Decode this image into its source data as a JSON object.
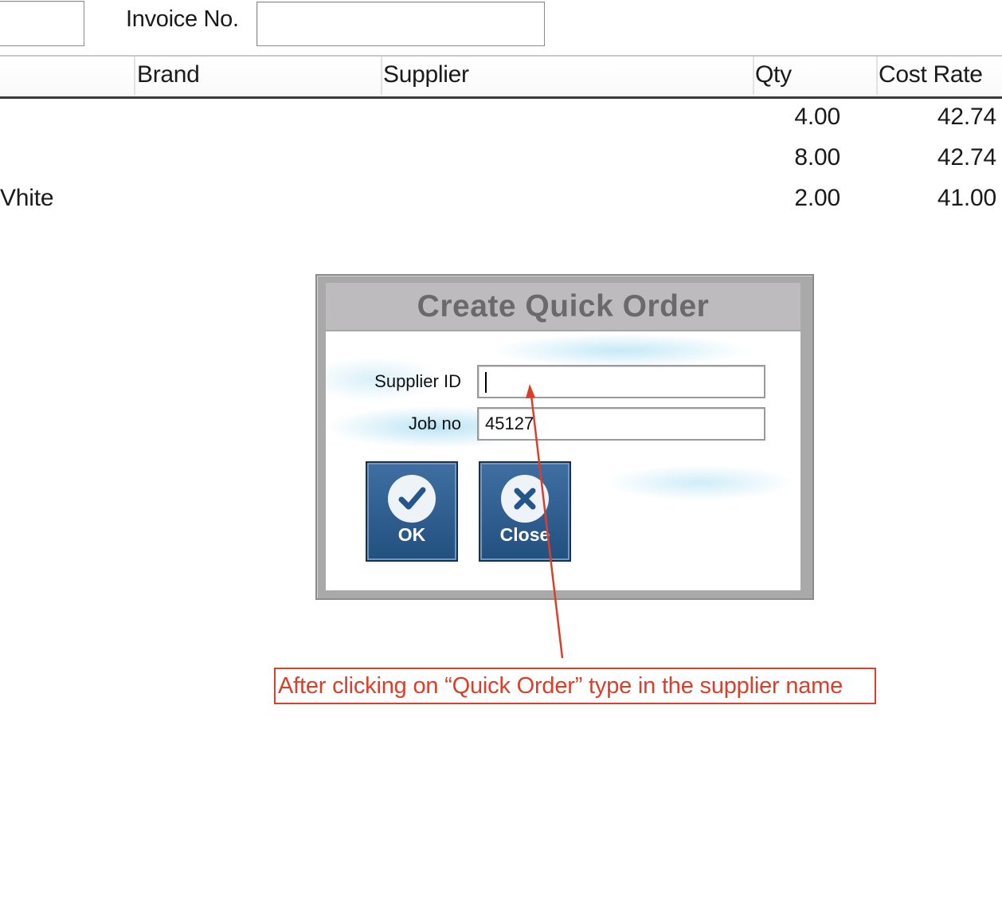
{
  "form": {
    "invoice_label": "Invoice No.",
    "invoice_value": ""
  },
  "grid": {
    "columns": [
      "Brand",
      "Supplier",
      "Qty",
      "Cost Rate"
    ],
    "rows": [
      {
        "name": "",
        "qty": "4.00",
        "cost_rate": "42.74"
      },
      {
        "name": "",
        "qty": "8.00",
        "cost_rate": "42.74"
      },
      {
        "name": "Vhite",
        "qty": "2.00",
        "cost_rate": "41.00"
      }
    ]
  },
  "dialog": {
    "title": "Create Quick Order",
    "supplier_id_label": "Supplier ID",
    "supplier_id_value": "",
    "job_no_label": "Job no",
    "job_no_value": "45127",
    "ok_label": "OK",
    "close_label": "Close",
    "ok_icon": "checkmark-icon",
    "close_icon": "x-icon"
  },
  "annotation": {
    "text": "After clicking on “Quick Order” type in the supplier name",
    "color": "#d9402b"
  },
  "colors": {
    "button_blue": "#2e5f93",
    "title_text": "#6a6a6a",
    "dialog_frame": "#a9a9a9"
  }
}
